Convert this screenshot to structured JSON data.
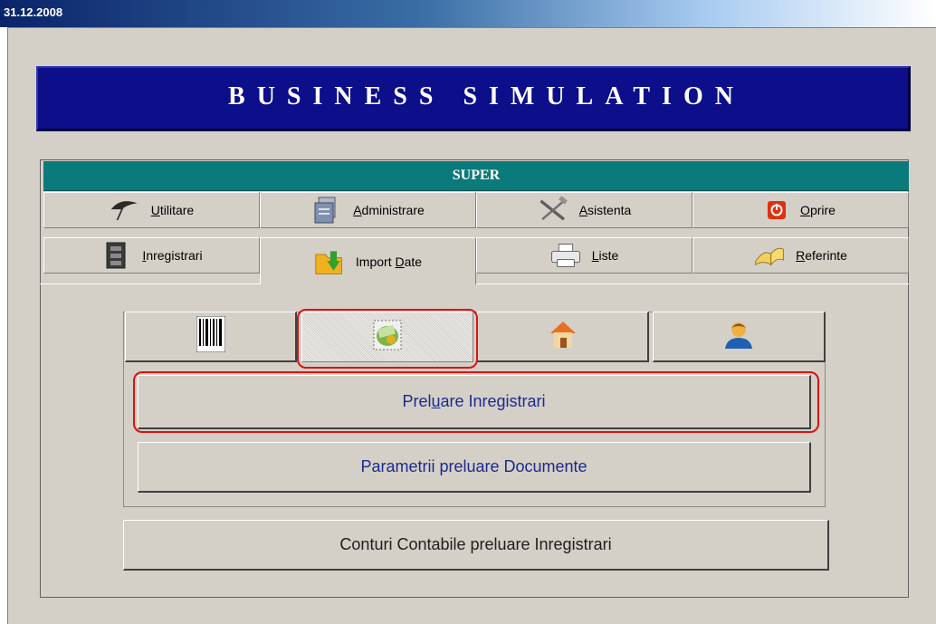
{
  "titlebar": {
    "date": "31.12.2008"
  },
  "banner": {
    "title": "BUSINESS SIMULATION"
  },
  "section": {
    "title": "SUPER"
  },
  "tabs_row1": [
    {
      "label": "Utilitare",
      "icon": "umbrella-icon"
    },
    {
      "label": "Administrare",
      "icon": "files-icon"
    },
    {
      "label": "Asistenta",
      "icon": "tools-icon"
    },
    {
      "label": "Oprire",
      "icon": "power-icon"
    }
  ],
  "tabs_row2": [
    {
      "label": "Inregistrari",
      "icon": "cabinet-icon"
    },
    {
      "label": "Import Date",
      "icon": "folder-import-icon",
      "active": true
    },
    {
      "label": "Liste",
      "icon": "printer-icon"
    },
    {
      "label": "Referinte",
      "icon": "book-icon"
    }
  ],
  "subtabs": [
    {
      "icon": "barcode-icon"
    },
    {
      "icon": "money-icon",
      "selected": true
    },
    {
      "icon": "house-icon"
    },
    {
      "icon": "person-icon"
    }
  ],
  "buttons": {
    "preluare_inregistrari": "Preluare Inregistrari",
    "parametrii_preluare": "Parametrii preluare Documente",
    "conturi_contabile": "Conturi Contabile preluare Inregistrari"
  },
  "colors": {
    "banner": "#0c0e8a",
    "section_bar": "#0a7a7a",
    "window": "#d4d0c8",
    "highlight": "#e01010"
  }
}
